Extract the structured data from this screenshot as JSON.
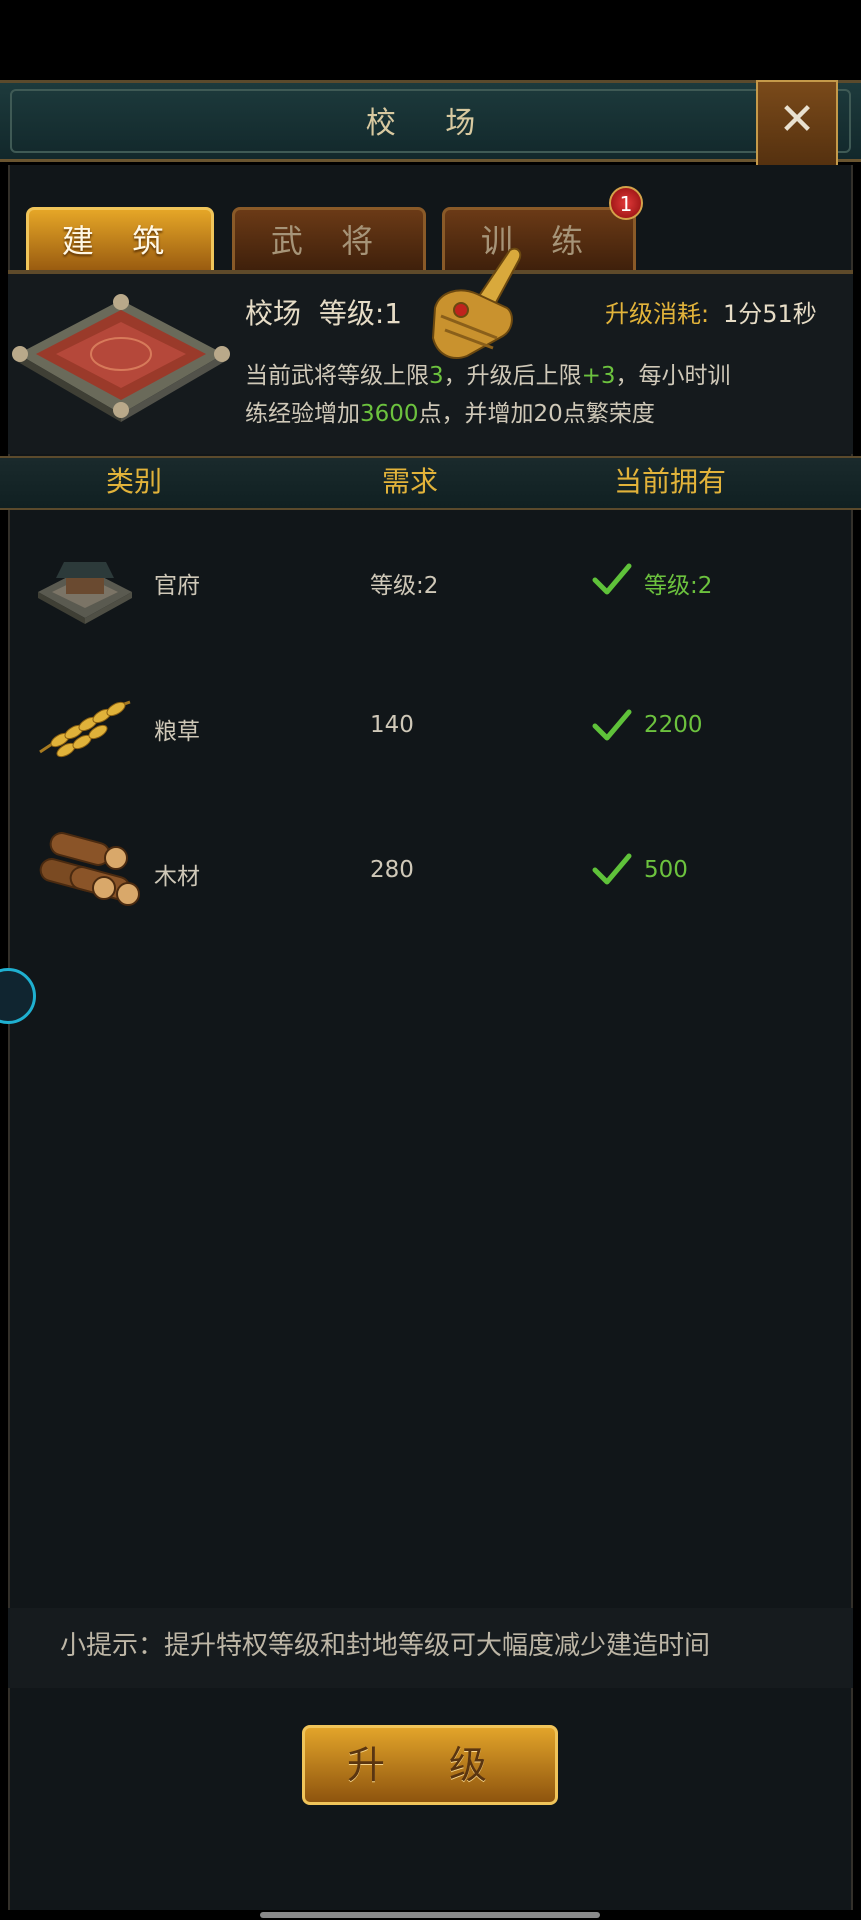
{
  "window": {
    "title": "校 场",
    "close_label": "✕"
  },
  "tabs": [
    {
      "label": "建 筑",
      "active": true
    },
    {
      "label": "武 将",
      "active": false
    },
    {
      "label": "训 练",
      "active": false,
      "badge": "1"
    }
  ],
  "building": {
    "name": "校场",
    "level_label": "等级:1",
    "cost_label": "升级消耗:",
    "cost_value": "1分51秒",
    "description": {
      "line1_a": "当前武将等级上限",
      "line1_b": "3",
      "line1_c": "，升级后上限",
      "line1_d": "+3",
      "line1_e": "，每小时训",
      "line2_a": "练经验增加",
      "line2_b": "3600",
      "line2_c": "点，并增加20点繁荣度"
    }
  },
  "table": {
    "headers": [
      "类别",
      "需求",
      "当前拥有"
    ],
    "rows": [
      {
        "icon": "government-building-icon",
        "category": "官府",
        "required": "等级:2",
        "owned": "等级:2"
      },
      {
        "icon": "grain-icon",
        "category": "粮草",
        "required": "140",
        "owned": "2200"
      },
      {
        "icon": "wood-logs-icon",
        "category": "木材",
        "required": "280",
        "owned": "500"
      }
    ]
  },
  "tip": "小提示：提升特权等级和封地等级可大幅度减少建造时间",
  "upgrade_button": "升 级",
  "colors": {
    "accent_gold": "#e2b33a",
    "ok_green": "#6cc23e",
    "panel_bg": "#111619"
  }
}
